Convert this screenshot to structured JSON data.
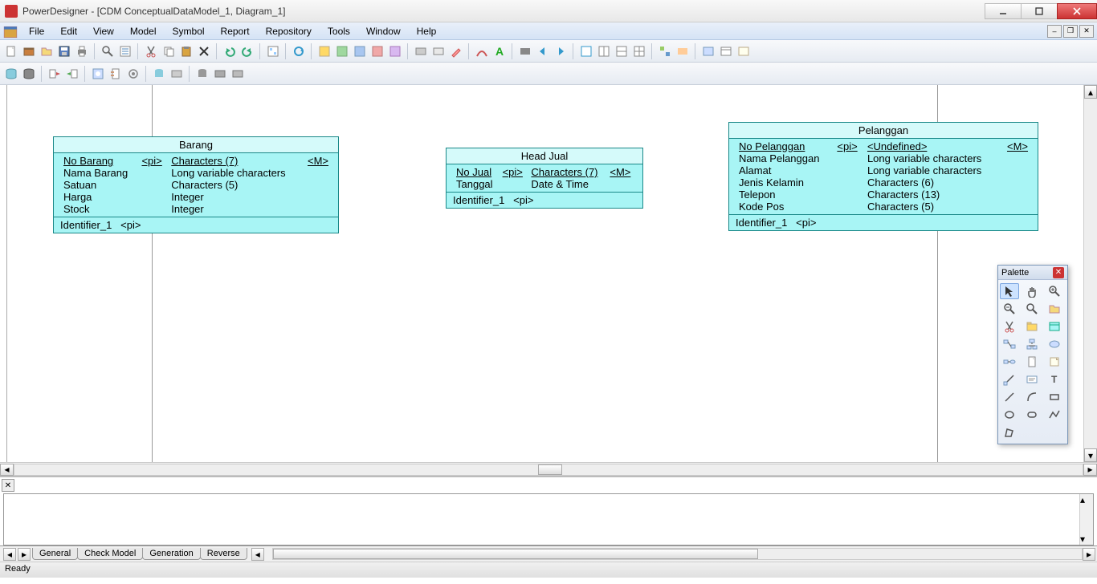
{
  "window": {
    "title": "PowerDesigner - [CDM ConceptualDataModel_1, Diagram_1]"
  },
  "menubar": [
    "File",
    "Edit",
    "View",
    "Model",
    "Symbol",
    "Report",
    "Repository",
    "Tools",
    "Window",
    "Help"
  ],
  "entities": {
    "barang": {
      "title": "Barang",
      "attrs": [
        {
          "name": "No Barang",
          "pi": "<pi>",
          "type": "Characters (7)",
          "m": "<M>",
          "u": true
        },
        {
          "name": "Nama Barang",
          "pi": "",
          "type": "Long variable characters",
          "m": ""
        },
        {
          "name": "Satuan",
          "pi": "",
          "type": "Characters (5)",
          "m": ""
        },
        {
          "name": "Harga",
          "pi": "",
          "type": "Integer",
          "m": ""
        },
        {
          "name": "Stock",
          "pi": "",
          "type": "Integer",
          "m": ""
        }
      ],
      "ident": {
        "name": "Identifier_1",
        "pi": "<pi>"
      }
    },
    "headjual": {
      "title": "Head Jual",
      "attrs": [
        {
          "name": "No Jual",
          "pi": "<pi>",
          "type": "Characters (7)",
          "m": "<M>",
          "u": true
        },
        {
          "name": "Tanggal",
          "pi": "",
          "type": "Date & Time",
          "m": ""
        }
      ],
      "ident": {
        "name": "Identifier_1",
        "pi": "<pi>"
      }
    },
    "pelanggan": {
      "title": "Pelanggan",
      "attrs": [
        {
          "name": "No Pelanggan",
          "pi": "<pi>",
          "type": "<Undefined>",
          "m": "<M>",
          "u": true
        },
        {
          "name": "Nama Pelanggan",
          "pi": "",
          "type": "Long variable characters",
          "m": ""
        },
        {
          "name": "Alamat",
          "pi": "",
          "type": "Long variable characters",
          "m": ""
        },
        {
          "name": "Jenis Kelamin",
          "pi": "",
          "type": "Characters (6)",
          "m": ""
        },
        {
          "name": "Telepon",
          "pi": "",
          "type": "Characters (13)",
          "m": ""
        },
        {
          "name": "Kode Pos",
          "pi": "",
          "type": "Characters (5)",
          "m": ""
        }
      ],
      "ident": {
        "name": "Identifier_1",
        "pi": "<pi>"
      }
    }
  },
  "bottom_tabs": [
    "General",
    "Check Model",
    "Generation",
    "Reverse"
  ],
  "status": "Ready",
  "palette": {
    "title": "Palette"
  }
}
